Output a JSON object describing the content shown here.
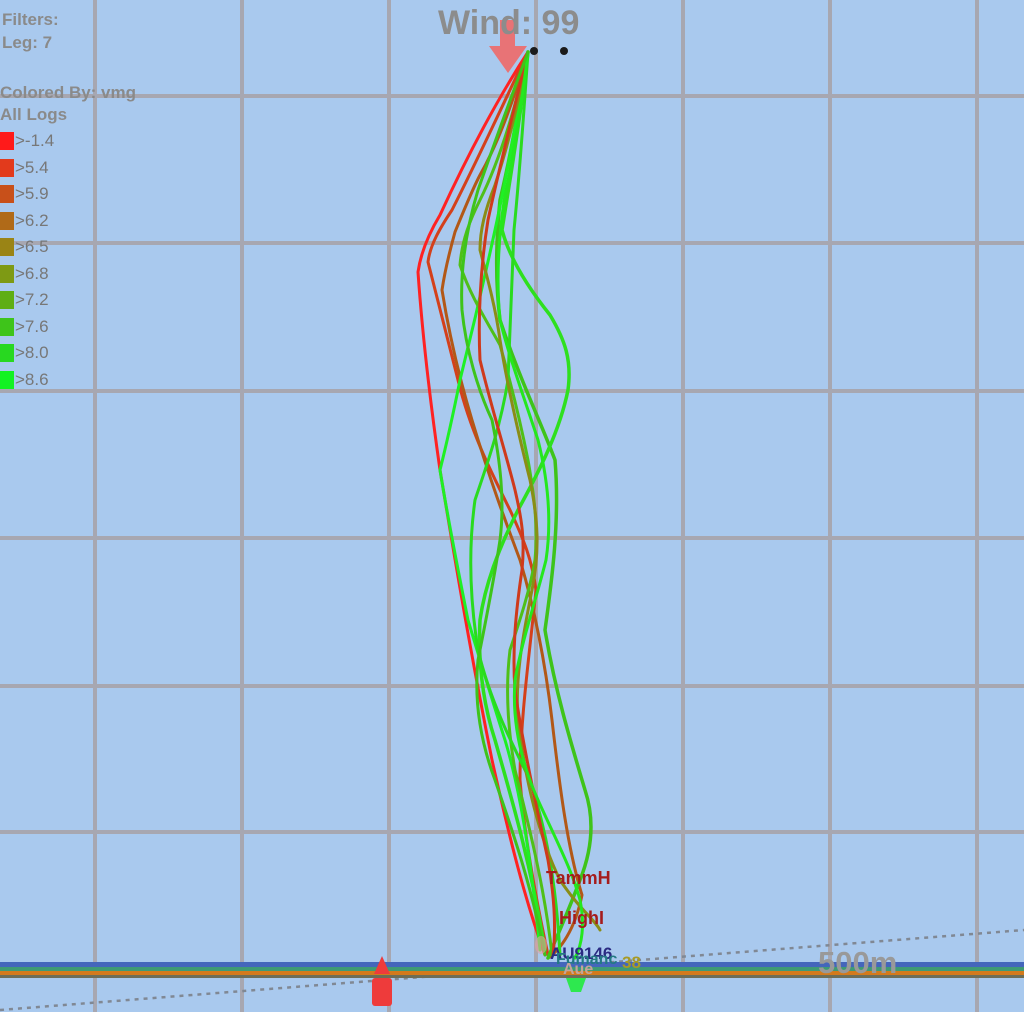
{
  "filters": {
    "title": "Filters:",
    "leg": "Leg: 7"
  },
  "legend": {
    "colored_by": "Colored By: vmg",
    "logs": "All Logs",
    "items": [
      {
        "label": ">-1.4",
        "color": "#ff1a1a"
      },
      {
        "label": ">5.4",
        "color": "#e23a1c"
      },
      {
        "label": ">5.9",
        "color": "#c8501a"
      },
      {
        "label": ">6.2",
        "color": "#b06a18"
      },
      {
        "label": ">6.5",
        "color": "#9a8415"
      },
      {
        "label": ">6.8",
        "color": "#7e9a14"
      },
      {
        "label": ">7.2",
        "color": "#5eae14"
      },
      {
        "label": ">7.6",
        "color": "#3ec41a"
      },
      {
        "label": ">8.0",
        "color": "#28d820"
      },
      {
        "label": ">8.6",
        "color": "#12f222"
      }
    ]
  },
  "wind": {
    "label": "Wind: 99"
  },
  "scale": {
    "label": "500m"
  },
  "boats": {
    "tammh": "TammH",
    "highl": "HighI",
    "au9146": "AU9146",
    "fumanc": "Fumanc",
    "num38": "38",
    "aue": "Aue"
  },
  "colors": {
    "water": "#a9c9ee",
    "grid": "#a7a7b1",
    "wind_arrow": "#ef6a6a",
    "mark_red": "#ee3b3b",
    "mark_green": "#2ee84f"
  }
}
